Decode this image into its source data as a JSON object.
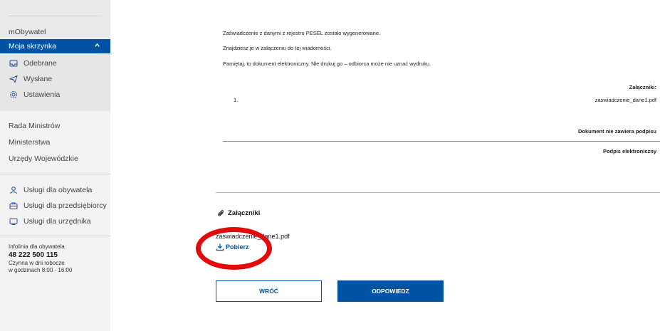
{
  "sidebar": {
    "brand": "mObywatel",
    "inbox": {
      "label": "Moja skrzynka",
      "chevron": "^"
    },
    "inbox_items": [
      {
        "label": "Odebrane",
        "icon": "inbox-icon"
      },
      {
        "label": "Wysłane",
        "icon": "send-icon"
      },
      {
        "label": "Ustawienia",
        "icon": "gear-icon"
      }
    ],
    "links": [
      "Rada Ministrów",
      "Ministerstwa",
      "Urzędy Wojewódzkie"
    ],
    "services": [
      {
        "label": "Usługi dla obywatela",
        "icon": "person-icon"
      },
      {
        "label": "Usługi dla przedsiębiorcy",
        "icon": "briefcase-icon"
      },
      {
        "label": "Usługi dla urzędnika",
        "icon": "monitor-icon"
      }
    ],
    "helpline": {
      "title": "Infolinia dla obywatela",
      "phone": "48 222 500 115",
      "hours1": "Czynna w dni robocze",
      "hours2": "w godzinach 8:00 - 16:00"
    }
  },
  "message": {
    "line1": "Zaświadczenie z danymi z rejestru PESEL zostało wygenerowane.",
    "line2": "Znajdziesz je w załączeniu do tej wiadomości.",
    "line3": "Pamiętaj, to dokument elektroniczny. Nie drukuj go – odbiorca może nie uznać wydruku.",
    "attachments_header": "Załączniki:",
    "attachment_number": "1.",
    "attachment_file": "zaswiadczenie_dane1.pdf",
    "no_signature": "Dokument nie zawiera podpisu",
    "e_signature": "Podpis elektroniczny"
  },
  "attachments": {
    "title": "Załączniki",
    "file": "zaswiadczenie_dane1.pdf",
    "download": "Pobierz"
  },
  "buttons": {
    "back": "WRÓĆ",
    "reply": "ODPOWIEDZ"
  },
  "colors": {
    "accent": "#0052a5",
    "annotation": "#e10b0b"
  }
}
